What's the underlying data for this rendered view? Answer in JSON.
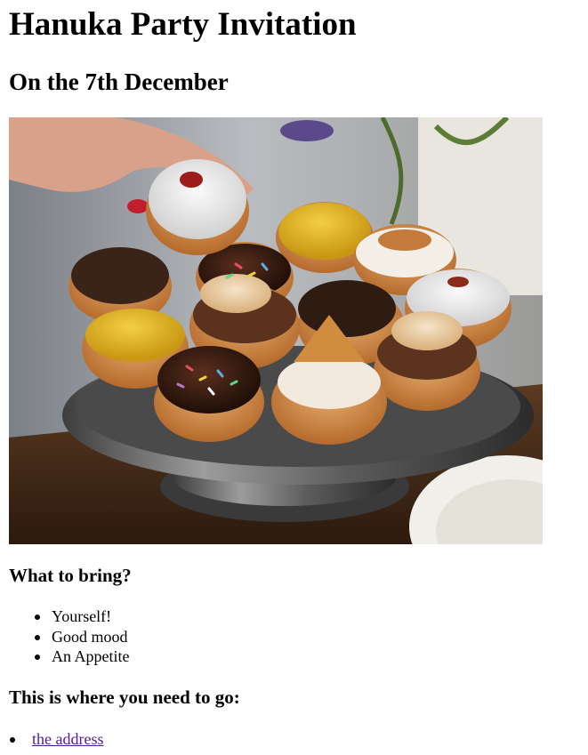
{
  "page": {
    "title": "Hanuka Party Invitation",
    "subtitle": "On the 7th December"
  },
  "image": {
    "alt": "A cake stand piled with decorated sufganiyot (jelly doughnuts) with a hand picking one up"
  },
  "bring_section": {
    "heading": "What to bring?",
    "items": [
      "Yourself!",
      "Good mood",
      "An Appetite"
    ]
  },
  "location_section": {
    "heading": "This is where you need to go:",
    "link_text": "the address",
    "link_color": "#551a8b"
  }
}
